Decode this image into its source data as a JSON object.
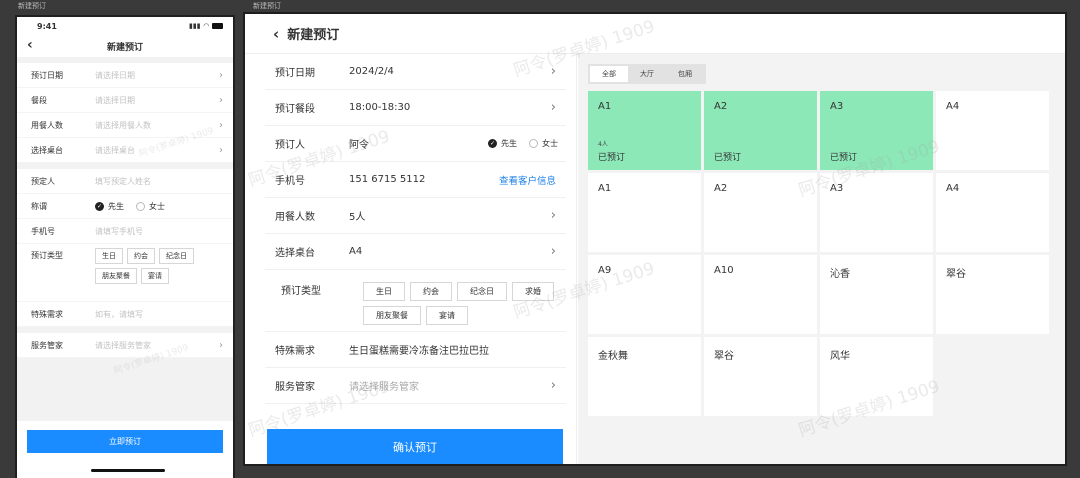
{
  "captions": {
    "phone": "新建预订",
    "tablet": "新建预订"
  },
  "watermark": "阿令(罗卓婷) 1909",
  "phone": {
    "time": "9:41",
    "title": "新建预订",
    "rows_group1": [
      {
        "label": "预订日期",
        "placeholder": "请选择日期"
      },
      {
        "label": "餐段",
        "placeholder": "请选择日期"
      },
      {
        "label": "用餐人数",
        "placeholder": "请选择用餐人数"
      },
      {
        "label": "选择桌台",
        "placeholder": "请选择桌台"
      }
    ],
    "name_row": {
      "label": "预定人",
      "placeholder": "填写预定人姓名"
    },
    "title_row": {
      "label": "称谓",
      "opt1": "先生",
      "opt2": "女士"
    },
    "phone_row": {
      "label": "手机号",
      "placeholder": "请填写手机号"
    },
    "type_row": {
      "label": "预订类型",
      "tags": [
        "生日",
        "约会",
        "纪念日",
        "朋友聚餐",
        "宴请"
      ]
    },
    "special_row": {
      "label": "特殊需求",
      "placeholder": "如有，请填写"
    },
    "butler_row": {
      "label": "服务管家",
      "placeholder": "请选择服务管家"
    },
    "submit": "立即预订"
  },
  "tablet": {
    "title": "新建预订",
    "date": {
      "label": "预订日期",
      "value": "2024/2/4"
    },
    "period": {
      "label": "预订餐段",
      "value": "18:00-18:30"
    },
    "person": {
      "label": "预订人",
      "value": "阿令",
      "opt1": "先生",
      "opt2": "女士"
    },
    "mobile": {
      "label": "手机号",
      "value": "151 6715 5112",
      "link": "查看客户信息"
    },
    "diners": {
      "label": "用餐人数",
      "value": "5人"
    },
    "table": {
      "label": "选择桌台",
      "value": "A4"
    },
    "type": {
      "label": "预订类型",
      "tags": [
        "生日",
        "约会",
        "纪念日",
        "求婚",
        "朋友聚餐",
        "宴请"
      ]
    },
    "special": {
      "label": "特殊需求",
      "value": "生日蛋糕需要冷冻备注巴拉巴拉"
    },
    "butler": {
      "label": "服务管家",
      "placeholder": "请选择服务管家"
    },
    "submit": "确认预订",
    "tabs": [
      "全部",
      "大厅",
      "包厢"
    ],
    "tables": [
      {
        "name": "A1",
        "count": "4人",
        "status": "已预订"
      },
      {
        "name": "A2",
        "count": "",
        "status": "已预订"
      },
      {
        "name": "A3",
        "count": "",
        "status": "已预订"
      },
      {
        "name": "A4",
        "count": "",
        "status": ""
      },
      {
        "name": "A1",
        "count": "",
        "status": ""
      },
      {
        "name": "A2",
        "count": "",
        "status": ""
      },
      {
        "name": "A3",
        "count": "",
        "status": ""
      },
      {
        "name": "A4",
        "count": "",
        "status": ""
      },
      {
        "name": "A9",
        "count": "",
        "status": ""
      },
      {
        "name": "A10",
        "count": "",
        "status": ""
      },
      {
        "name": "沁香",
        "count": "",
        "status": ""
      },
      {
        "name": "翠谷",
        "count": "",
        "status": ""
      },
      {
        "name": "金秋舞",
        "count": "",
        "status": ""
      },
      {
        "name": "翠谷",
        "count": "",
        "status": ""
      },
      {
        "name": "风华",
        "count": "",
        "status": ""
      }
    ]
  },
  "colors": {
    "primary": "#1a8cff",
    "booked": "#8de8b8",
    "link": "#1a7fe8"
  }
}
